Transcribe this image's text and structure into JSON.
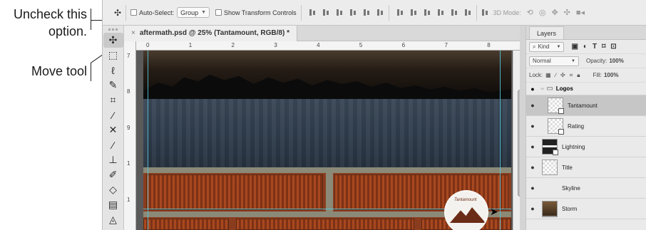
{
  "callouts": {
    "uncheck": "Uncheck this option.",
    "move_tool": "Move tool"
  },
  "options_bar": {
    "auto_select_label": "Auto-Select:",
    "auto_select_checked": false,
    "auto_select_target": "Group",
    "show_transform_label": "Show Transform Controls",
    "mode_3d_label": "3D Mode:"
  },
  "document": {
    "tab_title": "aftermath.psd @ 25% (Tantamount, RGB/8) *",
    "ruler_top": [
      "0",
      "1",
      "2",
      "3",
      "4",
      "5",
      "6",
      "7",
      "8"
    ],
    "ruler_left": [
      "7",
      "8",
      "9",
      "1",
      "1"
    ],
    "logo_arc_text": "Tantamount"
  },
  "layers_panel": {
    "tab_label": "Layers",
    "filter_label": "Kind",
    "blend_mode": "Normal",
    "opacity_label": "Opacity:",
    "opacity_value": "100%",
    "lock_label": "Lock:",
    "fill_label": "Fill:",
    "fill_value": "100%",
    "group_name": "Logos",
    "layers": [
      {
        "name": "Tantamount",
        "selected": true
      },
      {
        "name": "Rating"
      },
      {
        "name": "Lightning"
      },
      {
        "name": "Title"
      },
      {
        "name": "Skyline"
      },
      {
        "name": "Storm"
      }
    ]
  },
  "tool_icons": [
    "move-icon",
    "marquee-icon",
    "lasso-icon",
    "quick-select-icon",
    "crop-icon",
    "eyedropper-icon",
    "healing-icon",
    "brush-icon",
    "clone-stamp-icon",
    "history-brush-icon",
    "eraser-icon",
    "gradient-icon",
    "blur-icon"
  ]
}
